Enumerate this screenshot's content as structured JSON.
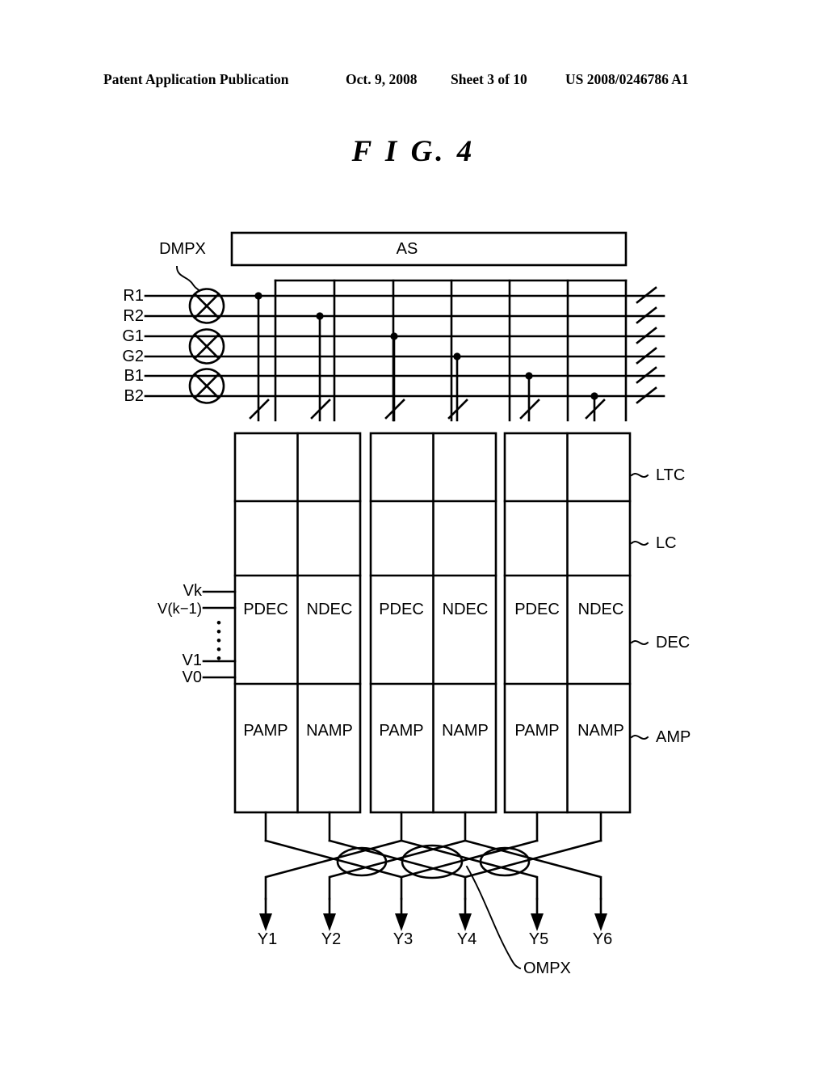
{
  "header": {
    "publication": "Patent Application Publication",
    "date": "Oct. 9, 2008",
    "sheet": "Sheet 3 of 10",
    "number": "US 2008/0246786 A1"
  },
  "figure": {
    "title": "F I G.  4"
  },
  "diagram": {
    "top_block_label": "AS",
    "demux_label": "DMPX",
    "output_mux_label": "OMPX",
    "input_signals": [
      "R1",
      "R2",
      "G1",
      "G2",
      "B1",
      "B2"
    ],
    "voltage_inputs": [
      "Vk",
      "V(k−1)",
      "V1",
      "V0"
    ],
    "voltage_ellipsis": "•",
    "row_labels": [
      "LTC",
      "LC",
      "DEC",
      "AMP"
    ],
    "column_groups": [
      {
        "decoders": [
          "PDEC",
          "NDEC"
        ],
        "amplifiers": [
          "PAMP",
          "NAMP"
        ]
      },
      {
        "decoders": [
          "PDEC",
          "NDEC"
        ],
        "amplifiers": [
          "PAMP",
          "NAMP"
        ]
      },
      {
        "decoders": [
          "PDEC",
          "NDEC"
        ],
        "amplifiers": [
          "PAMP",
          "NAMP"
        ]
      }
    ],
    "outputs": [
      "Y1",
      "Y2",
      "Y3",
      "Y4",
      "Y5",
      "Y6"
    ],
    "stroke_color": "#000000",
    "background_color": "#ffffff"
  }
}
